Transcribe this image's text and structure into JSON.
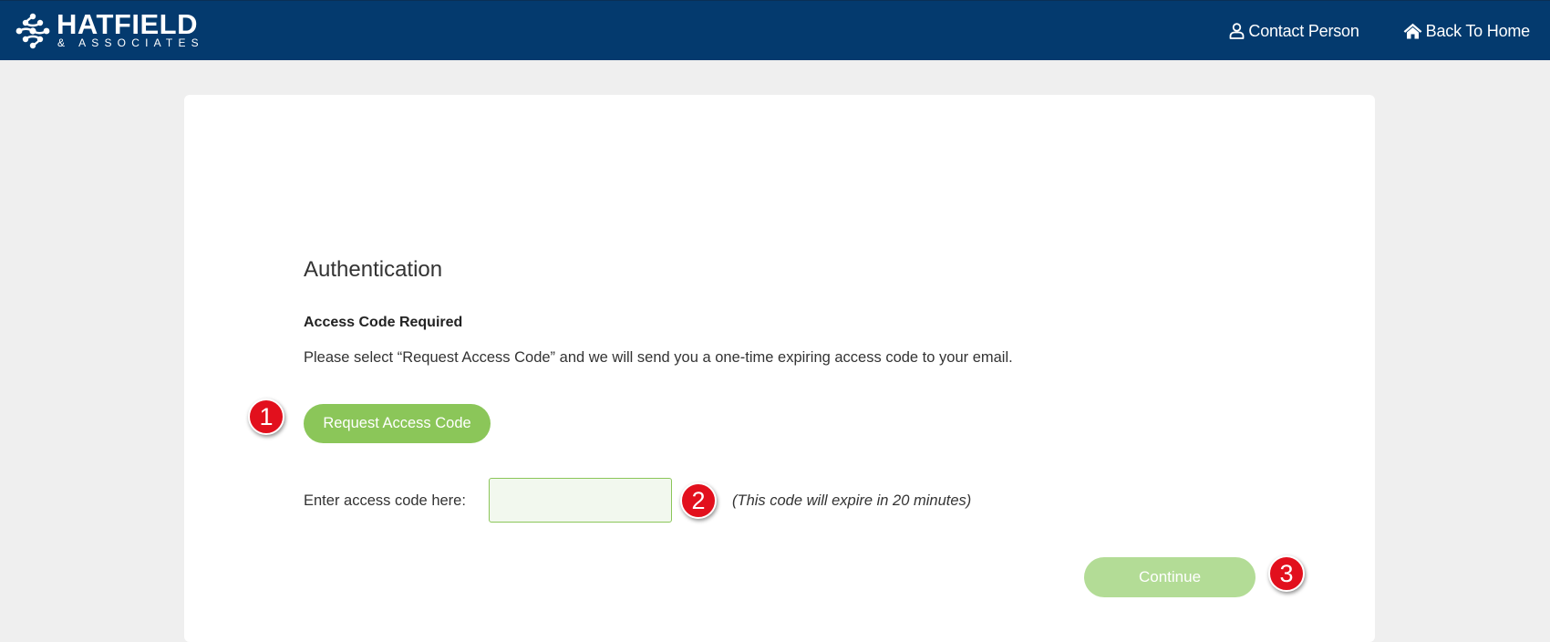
{
  "header": {
    "logo": {
      "main": "HATFIELD",
      "sub": "& ASSOCIATES"
    },
    "nav": [
      {
        "label": "Contact Person",
        "icon": "user-icon"
      },
      {
        "label": "Back To Home",
        "icon": "home-icon"
      }
    ],
    "colors": {
      "background": "#043a6e",
      "text": "#ffffff"
    }
  },
  "main": {
    "title": "Authentication",
    "subheading": "Access Code Required",
    "instructions": "Please select “Request Access Code” and we will send you a one-time expiring access code to your email.",
    "request_button": "Request Access Code",
    "code_label": "Enter access code here:",
    "code_input_value": "",
    "expire_note": "(This code will expire in 20 minutes)",
    "continue_button": "Continue"
  },
  "markers": [
    "1",
    "2",
    "3"
  ],
  "colors": {
    "accent_green": "#8bc659",
    "disabled_green": "#b3dc96",
    "marker_red": "#e2101d",
    "page_background": "#efefef"
  }
}
